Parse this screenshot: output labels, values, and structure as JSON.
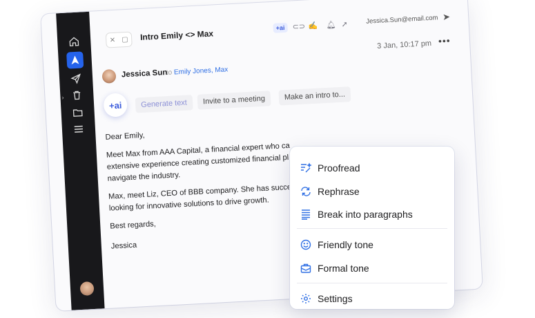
{
  "window": {
    "subject": "Intro Emily <> Max",
    "toolbar": {
      "ai_chip": "+ai",
      "from_email": "Jessica.Sun@email.com"
    },
    "date": "3 Jan, 10:17 pm",
    "sender": {
      "name": "Jessica Sun",
      "to_prefix": "to",
      "to_names": "Emily Jones, Max"
    },
    "ai_button": "+ai",
    "chips": [
      "Generate text",
      "Invite to a meeting",
      "Make an intro to..."
    ],
    "body": {
      "greeting": "Dear Emily,",
      "p1": "Meet Max from AAA Capital, a financial expert who ca",
      "p1b": "extensive experience creating customized financial pl",
      "p1c": "navigate the industry.",
      "p2": "Max, meet Liz, CEO of BBB company. She has succes",
      "p2b": "looking for innovative solutions to drive growth.",
      "closing": "Best regards,",
      "signature": "Jessica"
    }
  },
  "menu": {
    "items": [
      {
        "label": "Proofread",
        "icon": "proofread-icon"
      },
      {
        "label": "Rephrase",
        "icon": "rephrase-icon"
      },
      {
        "label": "Break into paragraphs",
        "icon": "paragraphs-icon"
      },
      {
        "label": "Friendly tone",
        "icon": "smile-icon"
      },
      {
        "label": "Formal tone",
        "icon": "briefcase-icon"
      },
      {
        "label": "Settings",
        "icon": "gear-icon"
      }
    ]
  },
  "colors": {
    "accent": "#2563eb",
    "sidebar": "#18181b",
    "ai": "#3b5bdb"
  }
}
